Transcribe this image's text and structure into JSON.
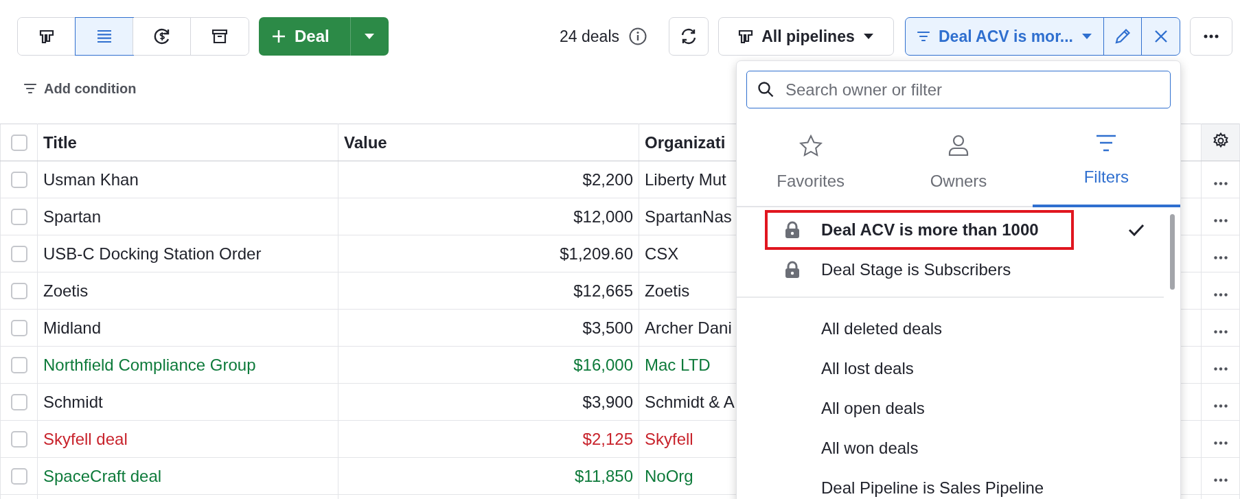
{
  "toolbar": {
    "view_buttons": [
      {
        "kind": "pipeline",
        "selected": false
      },
      {
        "kind": "list",
        "selected": true
      },
      {
        "kind": "forecast",
        "selected": false
      },
      {
        "kind": "archive",
        "selected": false
      }
    ],
    "add_button": {
      "label": "Deal"
    },
    "deal_count": "24 deals",
    "pipeline_select": {
      "label": "All pipelines"
    },
    "filter_select": {
      "label": "Deal ACV is mor..."
    }
  },
  "add_condition": "Add condition",
  "table": {
    "all_checked": false,
    "columns": [
      "Title",
      "Value",
      "Organizati"
    ],
    "rows": [
      {
        "title": "Usman Khan",
        "value": "$2,200",
        "organization": "Liberty Mut",
        "color": "#21232c",
        "checked": false
      },
      {
        "title": "Spartan",
        "value": "$12,000",
        "organization": "SpartanNas",
        "color": "#21232c",
        "checked": false
      },
      {
        "title": "USB-C Docking Station Order",
        "value": "$1,209.60",
        "organization": "CSX",
        "color": "#21232c",
        "checked": false
      },
      {
        "title": "Zoetis",
        "value": "$12,665",
        "organization": "Zoetis",
        "color": "#21232c",
        "checked": false
      },
      {
        "title": "Midland",
        "value": "$3,500",
        "organization": "Archer Dani",
        "color": "#21232c",
        "checked": false
      },
      {
        "title": "Northfield Compliance Group",
        "value": "$16,000",
        "organization": "Mac LTD",
        "color": "#0d7a3a",
        "checked": false
      },
      {
        "title": "Schmidt",
        "value": "$3,900",
        "organization": "Schmidt & A",
        "color": "#21232c",
        "checked": false
      },
      {
        "title": "Skyfell deal",
        "value": "$2,125",
        "organization": "Skyfell",
        "color": "#c8232c",
        "checked": false
      },
      {
        "title": "SpaceCraft deal",
        "value": "$11,850",
        "organization": "NoOrg",
        "color": "#0d7a3a",
        "checked": false
      }
    ]
  },
  "dropdown": {
    "search": {
      "placeholder": "Search owner or filter"
    },
    "tabs": [
      {
        "kind": "favorites",
        "label": "Favorites",
        "selected": false
      },
      {
        "kind": "owners",
        "label": "Owners",
        "selected": false
      },
      {
        "kind": "filters",
        "label": "Filters",
        "selected": true
      }
    ],
    "locked_filters": [
      {
        "label": "Deal ACV is more than 1000",
        "selected": true,
        "highlighted": true
      },
      {
        "label": "Deal Stage is Subscribers",
        "selected": false,
        "highlighted": false
      }
    ],
    "filters": [
      {
        "label": "All deleted deals"
      },
      {
        "label": "All lost deals"
      },
      {
        "label": "All open deals"
      },
      {
        "label": "All won deals"
      },
      {
        "label": "Deal Pipeline is Sales Pipeline"
      }
    ]
  }
}
